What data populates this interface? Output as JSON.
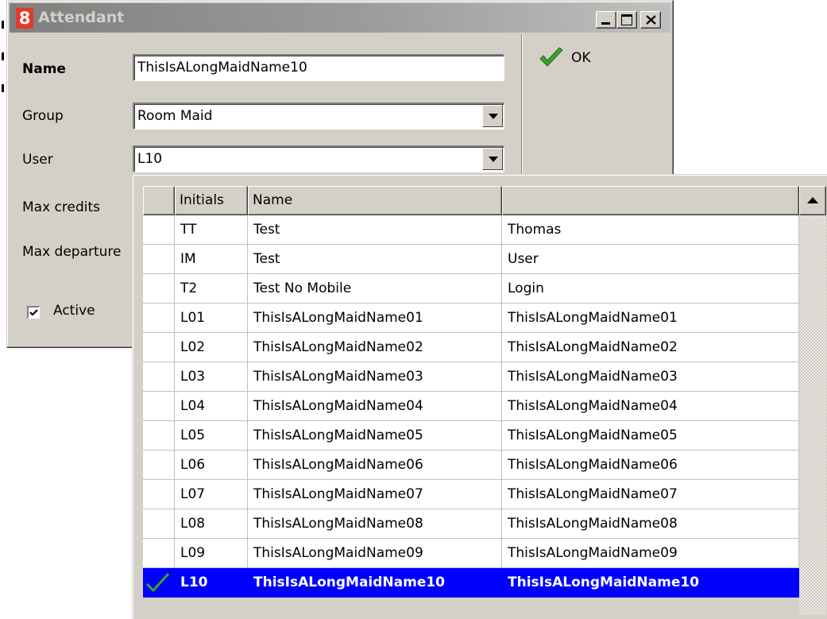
{
  "window": {
    "title": "Attendant",
    "app_icon_text": "8"
  },
  "form": {
    "name_label": "Name",
    "name_value": "ThisIsALongMaidName10",
    "group_label": "Group",
    "group_value": "Room Maid",
    "user_label": "User",
    "user_value": "L10",
    "max_credits_label": "Max credits",
    "max_departures_label": "Max departure",
    "active_label": "Active",
    "active_checked": true
  },
  "buttons": {
    "ok_label": "OK"
  },
  "grid": {
    "headers": [
      "",
      "Initials",
      "Name",
      ""
    ],
    "rows": [
      {
        "initials": "TT",
        "name": "Test",
        "extra": "Thomas"
      },
      {
        "initials": "IM",
        "name": "Test",
        "extra": "User"
      },
      {
        "initials": "T2",
        "name": "Test No Mobile",
        "extra": "Login"
      },
      {
        "initials": "L01",
        "name": "ThisIsALongMaidName01",
        "extra": "ThisIsALongMaidName01"
      },
      {
        "initials": "L02",
        "name": "ThisIsALongMaidName02",
        "extra": "ThisIsALongMaidName02"
      },
      {
        "initials": "L03",
        "name": "ThisIsALongMaidName03",
        "extra": "ThisIsALongMaidName03"
      },
      {
        "initials": "L04",
        "name": "ThisIsALongMaidName04",
        "extra": "ThisIsALongMaidName04"
      },
      {
        "initials": "L05",
        "name": "ThisIsALongMaidName05",
        "extra": "ThisIsALongMaidName05"
      },
      {
        "initials": "L06",
        "name": "ThisIsALongMaidName06",
        "extra": "ThisIsALongMaidName06"
      },
      {
        "initials": "L07",
        "name": "ThisIsALongMaidName07",
        "extra": "ThisIsALongMaidName07"
      },
      {
        "initials": "L08",
        "name": "ThisIsALongMaidName08",
        "extra": "ThisIsALongMaidName08"
      },
      {
        "initials": "L09",
        "name": "ThisIsALongMaidName09",
        "extra": "ThisIsALongMaidName09"
      },
      {
        "initials": "L10",
        "name": "ThisIsALongMaidName10",
        "extra": "ThisIsALongMaidName10",
        "selected": true
      }
    ]
  },
  "colors": {
    "selection": "#0000ff",
    "window_face": "#d4d0c8",
    "app_icon": "#e23a2c",
    "check_green": "#3aa52a"
  },
  "icons": {
    "ok": "green-checkmark-icon",
    "selected_row": "green-checkmark-icon",
    "scroll_up": "up-arrow-icon"
  }
}
